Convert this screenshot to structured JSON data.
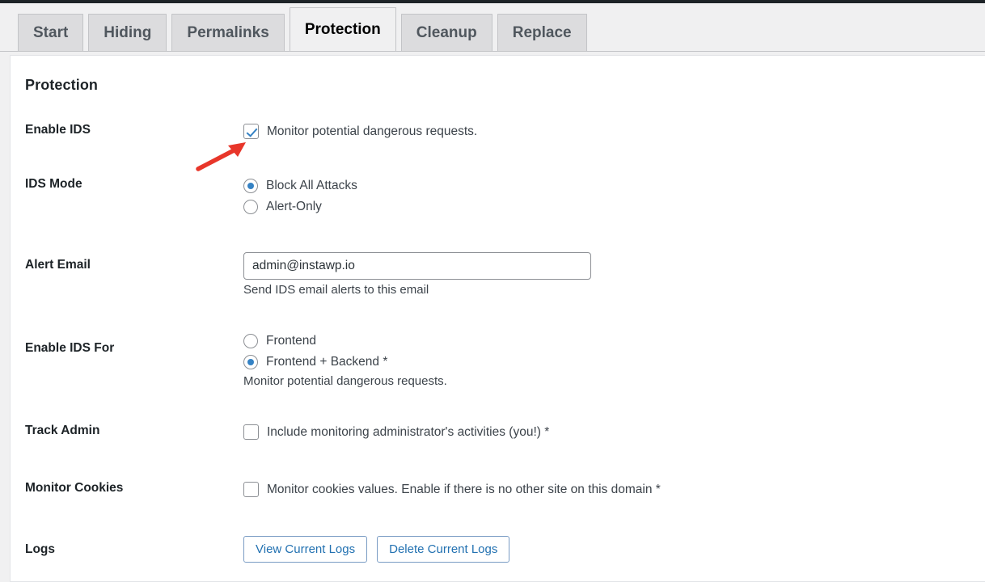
{
  "tabs": [
    {
      "label": "Start",
      "active": false
    },
    {
      "label": "Hiding",
      "active": false
    },
    {
      "label": "Permalinks",
      "active": false
    },
    {
      "label": "Protection",
      "active": true
    },
    {
      "label": "Cleanup",
      "active": false
    },
    {
      "label": "Replace",
      "active": false
    }
  ],
  "page": {
    "title": "Protection"
  },
  "rows": {
    "enable_ids": {
      "label": "Enable IDS",
      "checkbox_label": "Monitor potential dangerous requests.",
      "checked": true
    },
    "ids_mode": {
      "label": "IDS Mode",
      "options": [
        {
          "label": "Block All Attacks",
          "selected": true
        },
        {
          "label": "Alert-Only",
          "selected": false
        }
      ]
    },
    "alert_email": {
      "label": "Alert Email",
      "value": "admin@instawp.io",
      "placeholder": "",
      "help": "Send IDS email alerts to this email"
    },
    "enable_ids_for": {
      "label": "Enable IDS For",
      "options": [
        {
          "label": "Frontend",
          "selected": false
        },
        {
          "label": "Frontend + Backend *",
          "selected": true
        }
      ],
      "help": "Monitor potential dangerous requests."
    },
    "track_admin": {
      "label": "Track Admin",
      "checkbox_label": "Include monitoring administrator's activities (you!) *",
      "checked": false
    },
    "monitor_cookies": {
      "label": "Monitor Cookies",
      "checkbox_label": "Monitor cookies values. Enable if there is no other site on this domain *",
      "checked": false
    },
    "logs": {
      "label": "Logs",
      "view_button": "View Current Logs",
      "delete_button": "Delete Current Logs"
    }
  },
  "annotation": {
    "arrow_color": "#e8362a"
  },
  "colors": {
    "accent_blue": "#3582c4",
    "link_blue": "#2271b1",
    "page_bg": "#f0f0f1",
    "card_bg": "#ffffff",
    "tab_inactive_bg": "#dcdcde",
    "admin_bar": "#1d2327"
  }
}
